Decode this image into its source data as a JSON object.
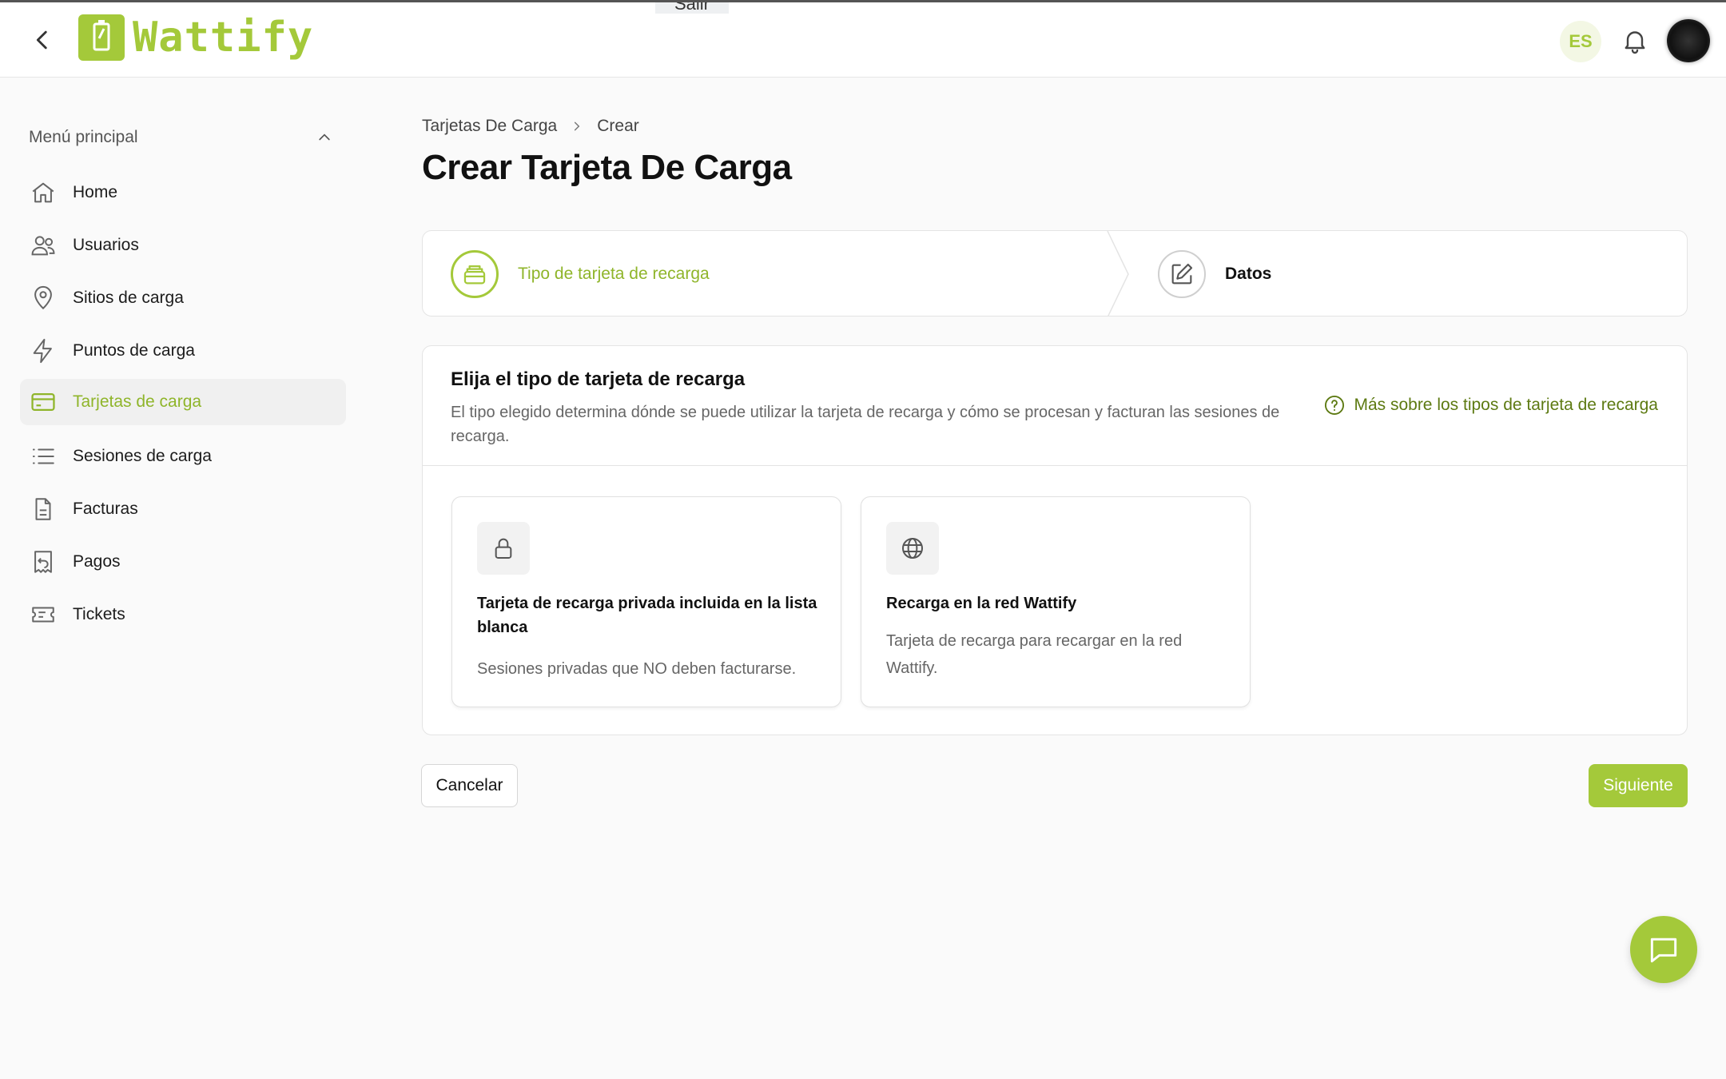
{
  "header": {
    "brand": "Wattify",
    "top_partial_text": "",
    "top_partial_button": "Salir",
    "language": "ES"
  },
  "sidebar": {
    "section_title": "Menú principal",
    "items": [
      {
        "label": "Home",
        "icon": "home-icon"
      },
      {
        "label": "Usuarios",
        "icon": "users-icon"
      },
      {
        "label": "Sitios de carga",
        "icon": "location-pin-icon"
      },
      {
        "label": "Puntos de carga",
        "icon": "lightning-icon"
      },
      {
        "label": "Tarjetas de carga",
        "icon": "card-icon",
        "active": true
      },
      {
        "label": "Sesiones de carga",
        "icon": "list-icon"
      },
      {
        "label": "Facturas",
        "icon": "document-icon"
      },
      {
        "label": "Pagos",
        "icon": "receipt-icon"
      },
      {
        "label": "Tickets",
        "icon": "ticket-icon"
      }
    ]
  },
  "breadcrumb": {
    "parent": "Tarjetas De Carga",
    "current": "Crear"
  },
  "page_title": "Crear Tarjeta De Carga",
  "stepper": {
    "steps": [
      {
        "label": "Tipo de tarjeta de recarga",
        "icon": "card-stack-icon",
        "state": "active"
      },
      {
        "label": "Datos",
        "icon": "pencil-edit-icon",
        "state": "pending"
      }
    ]
  },
  "panel": {
    "title": "Elija el tipo de tarjeta de recarga",
    "description": "El tipo elegido determina dónde se puede utilizar la tarjeta de recarga y cómo se procesan y facturan las sesiones de recarga.",
    "help_link": "Más sobre los tipos de tarjeta de recarga",
    "cards": [
      {
        "title": "Tarjeta de recarga privada incluida en la lista blanca",
        "description": "Sesiones privadas que NO deben facturarse.",
        "icon": "lock-icon"
      },
      {
        "title": "Recarga en la red Wattify",
        "description": "Tarjeta de recarga para recargar en la red Wattify.",
        "icon": "globe-icon"
      }
    ]
  },
  "actions": {
    "cancel": "Cancelar",
    "next": "Siguiente"
  },
  "colors": {
    "accent": "#a4c93a",
    "accent_text": "#8fb52a",
    "link": "#5d7a12"
  }
}
